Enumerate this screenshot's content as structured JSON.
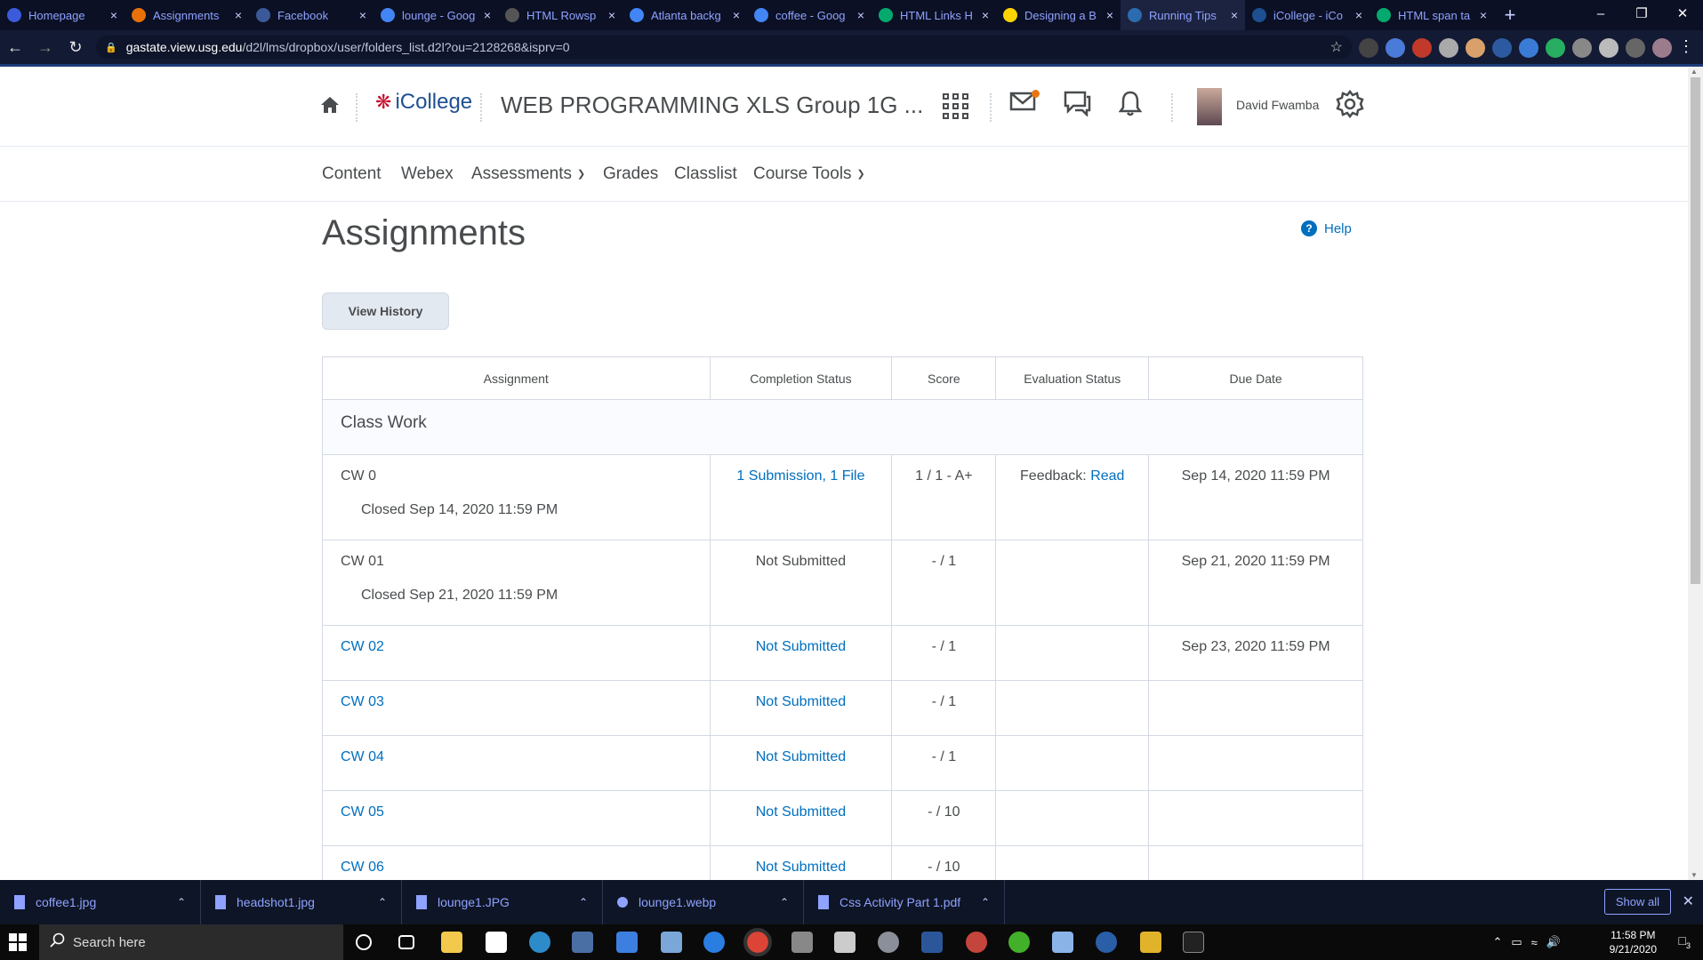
{
  "browser": {
    "tabs": [
      {
        "label": "Homepage",
        "color": "#3b5bdb",
        "active": false
      },
      {
        "label": "Assignments",
        "color": "#e8710a",
        "active": false
      },
      {
        "label": "Facebook",
        "color": "#3b5998",
        "active": false
      },
      {
        "label": "lounge - Goog",
        "color": "#4285f4",
        "active": false
      },
      {
        "label": "HTML Rowsp",
        "color": "#555555",
        "active": false
      },
      {
        "label": "Atlanta backg",
        "color": "#4285f4",
        "active": false
      },
      {
        "label": "coffee - Goog",
        "color": "#4285f4",
        "active": false
      },
      {
        "label": "HTML Links H",
        "color": "#04aa6d",
        "active": false
      },
      {
        "label": "Designing a B",
        "color": "#ffd400",
        "active": false
      },
      {
        "label": "Running Tips",
        "color": "#2b6cb0",
        "active": true
      },
      {
        "label": "iCollege - iCo",
        "color": "#1d4f91",
        "active": false
      },
      {
        "label": "HTML span ta",
        "color": "#04aa6d",
        "active": false
      }
    ],
    "url_host": "gastate.view.usg.edu",
    "url_path": "/d2l/lms/dropbox/user/folders_list.d2l?ou=2128268&isprv=0"
  },
  "header": {
    "logo_text": "iCollege",
    "course_title": "WEB PROGRAMMING XLS Group 1G ...",
    "user_name": "David Fwamba"
  },
  "nav": {
    "content": "Content",
    "webex": "Webex",
    "assessments": "Assessments",
    "grades": "Grades",
    "classlist": "Classlist",
    "course_tools": "Course Tools"
  },
  "page": {
    "title": "Assignments",
    "help": "Help",
    "view_history": "View History"
  },
  "table": {
    "headers": [
      "Assignment",
      "Completion Status",
      "Score",
      "Evaluation Status",
      "Due Date"
    ],
    "section": "Class Work",
    "feedback_label": "Feedback:",
    "feedback_link": "Read",
    "rows": [
      {
        "name": "CW 0",
        "closed": "Closed Sep 14, 2020 11:59 PM",
        "completion": "1 Submission, 1 File",
        "score": "1 / 1 - A+",
        "due": "Sep 14, 2020 11:59 PM"
      },
      {
        "name": "CW 01",
        "closed": "Closed Sep 21, 2020 11:59 PM",
        "completion": "Not Submitted",
        "score": "- / 1",
        "due": "Sep 21, 2020 11:59 PM"
      },
      {
        "name": "CW 02",
        "completion": "Not Submitted",
        "score": "- / 1",
        "due": "Sep 23, 2020 11:59 PM"
      },
      {
        "name": "CW 03",
        "completion": "Not Submitted",
        "score": "- / 1",
        "due": ""
      },
      {
        "name": "CW 04",
        "completion": "Not Submitted",
        "score": "- / 1",
        "due": ""
      },
      {
        "name": "CW 05",
        "completion": "Not Submitted",
        "score": "- / 10",
        "due": ""
      },
      {
        "name": "CW 06",
        "completion": "Not Submitted",
        "score": "- / 10",
        "due": ""
      }
    ]
  },
  "downloads": {
    "items": [
      "coffee1.jpg",
      "headshot1.jpg",
      "lounge1.JPG",
      "lounge1.webp",
      "Css Activity Part 1.pdf"
    ],
    "show_all": "Show all"
  },
  "taskbar": {
    "search_placeholder": "Search here",
    "time": "11:58 PM",
    "date": "9/21/2020",
    "notification_count": "3"
  },
  "colors": {
    "link": "#006fbf",
    "text": "#494c4e",
    "accent_red": "#c8102e"
  }
}
